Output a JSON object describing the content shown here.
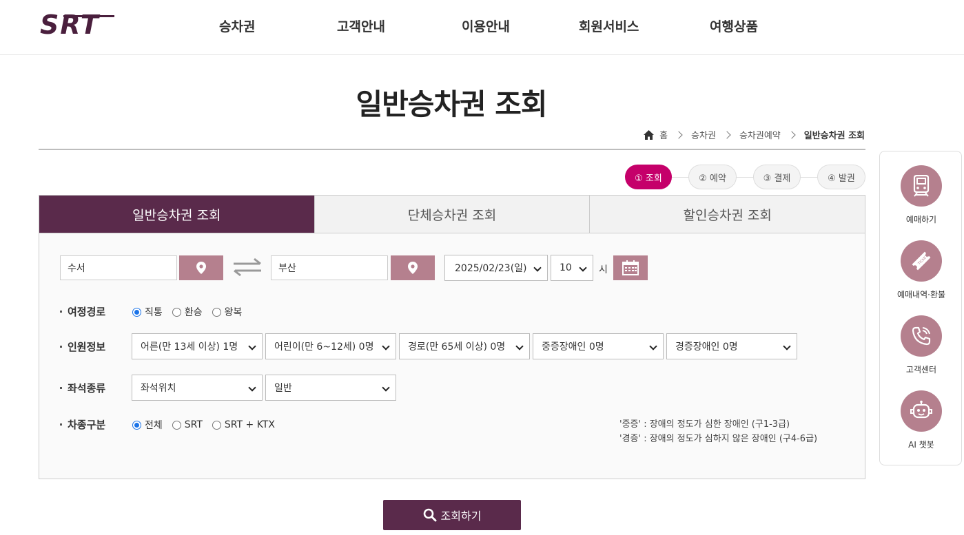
{
  "header": {
    "logo_text": "SRT",
    "nav": [
      "승차권",
      "고객안내",
      "이용안내",
      "회원서비스",
      "여행상품"
    ]
  },
  "page": {
    "title": "일반승차권 조회"
  },
  "breadcrumb": {
    "home": "홈",
    "items": [
      "승차권",
      "승차권예약"
    ],
    "current": "일반승차권 조회"
  },
  "steps": [
    "① 조회",
    "② 예약",
    "③ 결제",
    "④ 발권"
  ],
  "tabs": [
    "일반승차권 조회",
    "단체승차권 조회",
    "할인승차권 조회"
  ],
  "search": {
    "departure": "수서",
    "arrival": "부산",
    "date": "2025/02/23(일)",
    "hour": "10",
    "hour_unit": "시"
  },
  "route": {
    "label": "여정경로",
    "options": [
      "직통",
      "환승",
      "왕복"
    ],
    "selected": "직통"
  },
  "passengers": {
    "label": "인원정보",
    "selects": [
      "어른(만 13세 이상) 1명",
      "어린이(만 6~12세) 0명",
      "경로(만 65세 이상) 0명",
      "중증장애인 0명",
      "경증장애인 0명"
    ]
  },
  "seat": {
    "label": "좌석종류",
    "position": "좌석위치",
    "class": "일반"
  },
  "train_type": {
    "label": "차종구분",
    "options": [
      "전체",
      "SRT",
      "SRT + KTX"
    ],
    "selected": "전체"
  },
  "notes": [
    "'중증' : 장애의 정도가 심한 장애인 (구1-3급)",
    "'경증' : 장애의 정도가 심하지 않은 장애인 (구4-6급)"
  ],
  "search_button": "조회하기",
  "quick_menu": [
    "예매하기",
    "예매내역·환불",
    "고객센터",
    "AI 챗봇"
  ],
  "colors": {
    "primary": "#5a2a4b",
    "accent": "#c5006a",
    "pin": "#b5808e"
  }
}
